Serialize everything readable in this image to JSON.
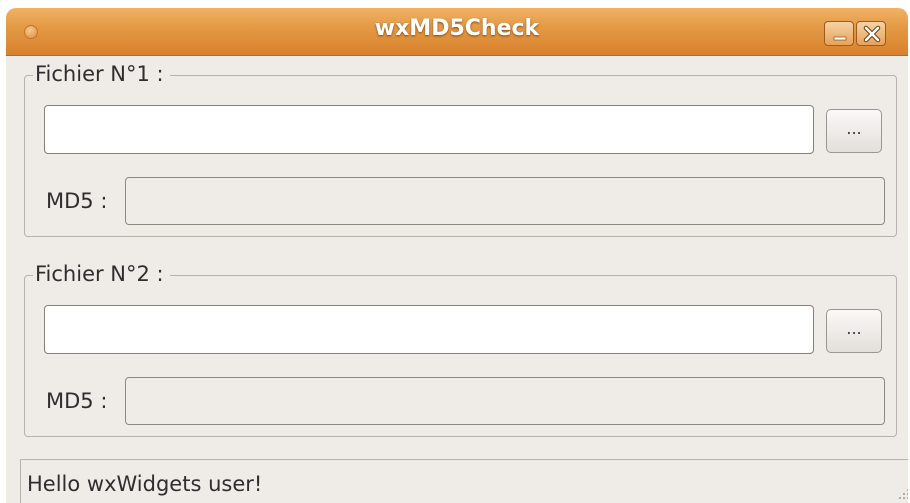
{
  "window": {
    "title": "wxMD5Check",
    "controls": {
      "minimize_icon": "minimize-icon",
      "close_icon": "close-icon"
    }
  },
  "file1": {
    "legend": "Fichier N°1 :",
    "path_value": "",
    "browse_label": "...",
    "md5_label": "MD5 :",
    "md5_value": ""
  },
  "file2": {
    "legend": "Fichier N°2 :",
    "path_value": "",
    "browse_label": "...",
    "md5_label": "MD5 :",
    "md5_value": ""
  },
  "statusbar": {
    "text": "Hello wxWidgets user!"
  },
  "colors": {
    "titlebar": "#e49a45",
    "window_bg": "#efebe7",
    "input_bg": "#ffffff"
  }
}
